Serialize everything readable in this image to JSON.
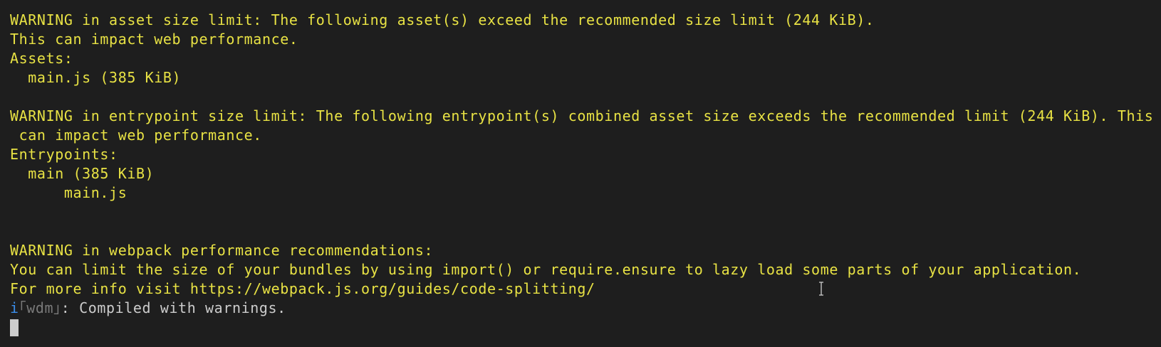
{
  "terminal": {
    "lines": [
      {
        "text": "WARNING in asset size limit: The following asset(s) exceed the recommended size limit (244 KiB)."
      },
      {
        "text": "This can impact web performance."
      },
      {
        "text": "Assets:"
      },
      {
        "text": "  main.js (385 KiB)"
      },
      {
        "text": ""
      },
      {
        "text": "WARNING in entrypoint size limit: The following entrypoint(s) combined asset size exceeds the recommended limit (244 KiB). This"
      },
      {
        "text": " can impact web performance."
      },
      {
        "text": "Entrypoints:"
      },
      {
        "text": "  main (385 KiB)"
      },
      {
        "text": "      main.js"
      },
      {
        "text": ""
      },
      {
        "text": ""
      },
      {
        "text": "WARNING in webpack performance recommendations:"
      },
      {
        "text": "You can limit the size of your bundles by using import() or require.ensure to lazy load some parts of your application."
      },
      {
        "text": "For more info visit https://webpack.js.org/guides/code-splitting/"
      }
    ],
    "status": {
      "info_symbol": "i",
      "tag": "｢wdm｣",
      "message": ": Compiled with warnings."
    }
  },
  "colors": {
    "background": "#1e1e1e",
    "warning_text": "#e8e244",
    "info_symbol": "#3b8eea",
    "tag_text": "#7a7a7a",
    "message_text": "#cccccc",
    "cursor": "#cccccc"
  },
  "icons": {
    "mouse_pointer": "text-ibeam-icon"
  }
}
